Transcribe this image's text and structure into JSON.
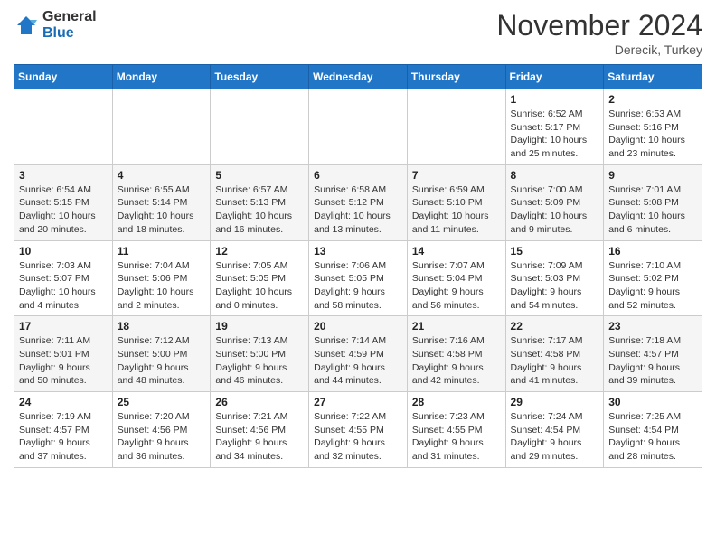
{
  "header": {
    "logo_general": "General",
    "logo_blue": "Blue",
    "month_title": "November 2024",
    "location": "Derecik, Turkey"
  },
  "days_of_week": [
    "Sunday",
    "Monday",
    "Tuesday",
    "Wednesday",
    "Thursday",
    "Friday",
    "Saturday"
  ],
  "weeks": [
    {
      "row": 1,
      "days": [
        {
          "date": "",
          "info": ""
        },
        {
          "date": "",
          "info": ""
        },
        {
          "date": "",
          "info": ""
        },
        {
          "date": "",
          "info": ""
        },
        {
          "date": "",
          "info": ""
        },
        {
          "date": "1",
          "info": "Sunrise: 6:52 AM\nSunset: 5:17 PM\nDaylight: 10 hours\nand 25 minutes."
        },
        {
          "date": "2",
          "info": "Sunrise: 6:53 AM\nSunset: 5:16 PM\nDaylight: 10 hours\nand 23 minutes."
        }
      ]
    },
    {
      "row": 2,
      "days": [
        {
          "date": "3",
          "info": "Sunrise: 6:54 AM\nSunset: 5:15 PM\nDaylight: 10 hours\nand 20 minutes."
        },
        {
          "date": "4",
          "info": "Sunrise: 6:55 AM\nSunset: 5:14 PM\nDaylight: 10 hours\nand 18 minutes."
        },
        {
          "date": "5",
          "info": "Sunrise: 6:57 AM\nSunset: 5:13 PM\nDaylight: 10 hours\nand 16 minutes."
        },
        {
          "date": "6",
          "info": "Sunrise: 6:58 AM\nSunset: 5:12 PM\nDaylight: 10 hours\nand 13 minutes."
        },
        {
          "date": "7",
          "info": "Sunrise: 6:59 AM\nSunset: 5:10 PM\nDaylight: 10 hours\nand 11 minutes."
        },
        {
          "date": "8",
          "info": "Sunrise: 7:00 AM\nSunset: 5:09 PM\nDaylight: 10 hours\nand 9 minutes."
        },
        {
          "date": "9",
          "info": "Sunrise: 7:01 AM\nSunset: 5:08 PM\nDaylight: 10 hours\nand 6 minutes."
        }
      ]
    },
    {
      "row": 3,
      "days": [
        {
          "date": "10",
          "info": "Sunrise: 7:03 AM\nSunset: 5:07 PM\nDaylight: 10 hours\nand 4 minutes."
        },
        {
          "date": "11",
          "info": "Sunrise: 7:04 AM\nSunset: 5:06 PM\nDaylight: 10 hours\nand 2 minutes."
        },
        {
          "date": "12",
          "info": "Sunrise: 7:05 AM\nSunset: 5:05 PM\nDaylight: 10 hours\nand 0 minutes."
        },
        {
          "date": "13",
          "info": "Sunrise: 7:06 AM\nSunset: 5:05 PM\nDaylight: 9 hours\nand 58 minutes."
        },
        {
          "date": "14",
          "info": "Sunrise: 7:07 AM\nSunset: 5:04 PM\nDaylight: 9 hours\nand 56 minutes."
        },
        {
          "date": "15",
          "info": "Sunrise: 7:09 AM\nSunset: 5:03 PM\nDaylight: 9 hours\nand 54 minutes."
        },
        {
          "date": "16",
          "info": "Sunrise: 7:10 AM\nSunset: 5:02 PM\nDaylight: 9 hours\nand 52 minutes."
        }
      ]
    },
    {
      "row": 4,
      "days": [
        {
          "date": "17",
          "info": "Sunrise: 7:11 AM\nSunset: 5:01 PM\nDaylight: 9 hours\nand 50 minutes."
        },
        {
          "date": "18",
          "info": "Sunrise: 7:12 AM\nSunset: 5:00 PM\nDaylight: 9 hours\nand 48 minutes."
        },
        {
          "date": "19",
          "info": "Sunrise: 7:13 AM\nSunset: 5:00 PM\nDaylight: 9 hours\nand 46 minutes."
        },
        {
          "date": "20",
          "info": "Sunrise: 7:14 AM\nSunset: 4:59 PM\nDaylight: 9 hours\nand 44 minutes."
        },
        {
          "date": "21",
          "info": "Sunrise: 7:16 AM\nSunset: 4:58 PM\nDaylight: 9 hours\nand 42 minutes."
        },
        {
          "date": "22",
          "info": "Sunrise: 7:17 AM\nSunset: 4:58 PM\nDaylight: 9 hours\nand 41 minutes."
        },
        {
          "date": "23",
          "info": "Sunrise: 7:18 AM\nSunset: 4:57 PM\nDaylight: 9 hours\nand 39 minutes."
        }
      ]
    },
    {
      "row": 5,
      "days": [
        {
          "date": "24",
          "info": "Sunrise: 7:19 AM\nSunset: 4:57 PM\nDaylight: 9 hours\nand 37 minutes."
        },
        {
          "date": "25",
          "info": "Sunrise: 7:20 AM\nSunset: 4:56 PM\nDaylight: 9 hours\nand 36 minutes."
        },
        {
          "date": "26",
          "info": "Sunrise: 7:21 AM\nSunset: 4:56 PM\nDaylight: 9 hours\nand 34 minutes."
        },
        {
          "date": "27",
          "info": "Sunrise: 7:22 AM\nSunset: 4:55 PM\nDaylight: 9 hours\nand 32 minutes."
        },
        {
          "date": "28",
          "info": "Sunrise: 7:23 AM\nSunset: 4:55 PM\nDaylight: 9 hours\nand 31 minutes."
        },
        {
          "date": "29",
          "info": "Sunrise: 7:24 AM\nSunset: 4:54 PM\nDaylight: 9 hours\nand 29 minutes."
        },
        {
          "date": "30",
          "info": "Sunrise: 7:25 AM\nSunset: 4:54 PM\nDaylight: 9 hours\nand 28 minutes."
        }
      ]
    }
  ]
}
